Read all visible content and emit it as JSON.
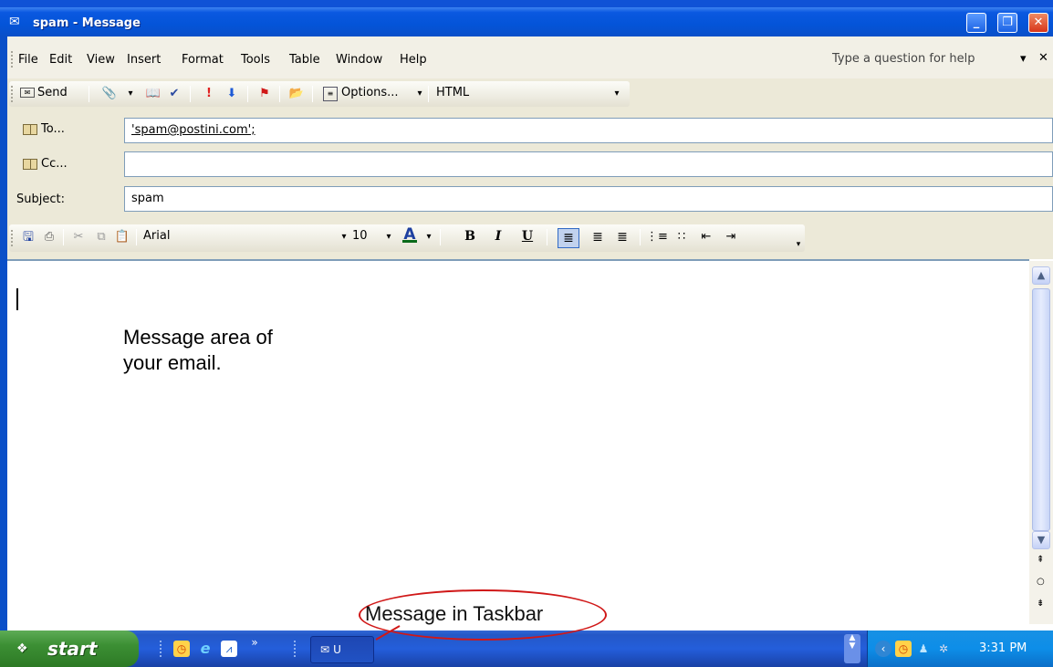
{
  "window": {
    "title": "spam - Message"
  },
  "menu": {
    "items": [
      "File",
      "Edit",
      "View",
      "Insert",
      "Format",
      "Tools",
      "Table",
      "Window",
      "Help"
    ],
    "help_placeholder": "Type a question for help"
  },
  "toolbar": {
    "send_label": "Send",
    "options_label": "Options...",
    "format_value": "HTML"
  },
  "header": {
    "to_label": "To...",
    "to_value": "'spam@postini.com';",
    "cc_label": "Cc...",
    "cc_value": "",
    "subject_label": "Subject:",
    "subject_value": "spam"
  },
  "format_toolbar": {
    "font": "Arial",
    "size": "10",
    "bold": "B",
    "italic": "I",
    "underline": "U"
  },
  "message": {
    "line1": "Message area of",
    "line2": "your email."
  },
  "annotation": {
    "text": "Message in Taskbar"
  },
  "taskbar": {
    "start_label": "start",
    "task_label": "U",
    "clock": "3:31 PM"
  },
  "colors": {
    "titlebar": "#0454d8",
    "taskbar": "#245edb",
    "start": "#3c8f34",
    "annotation": "#d01818"
  }
}
